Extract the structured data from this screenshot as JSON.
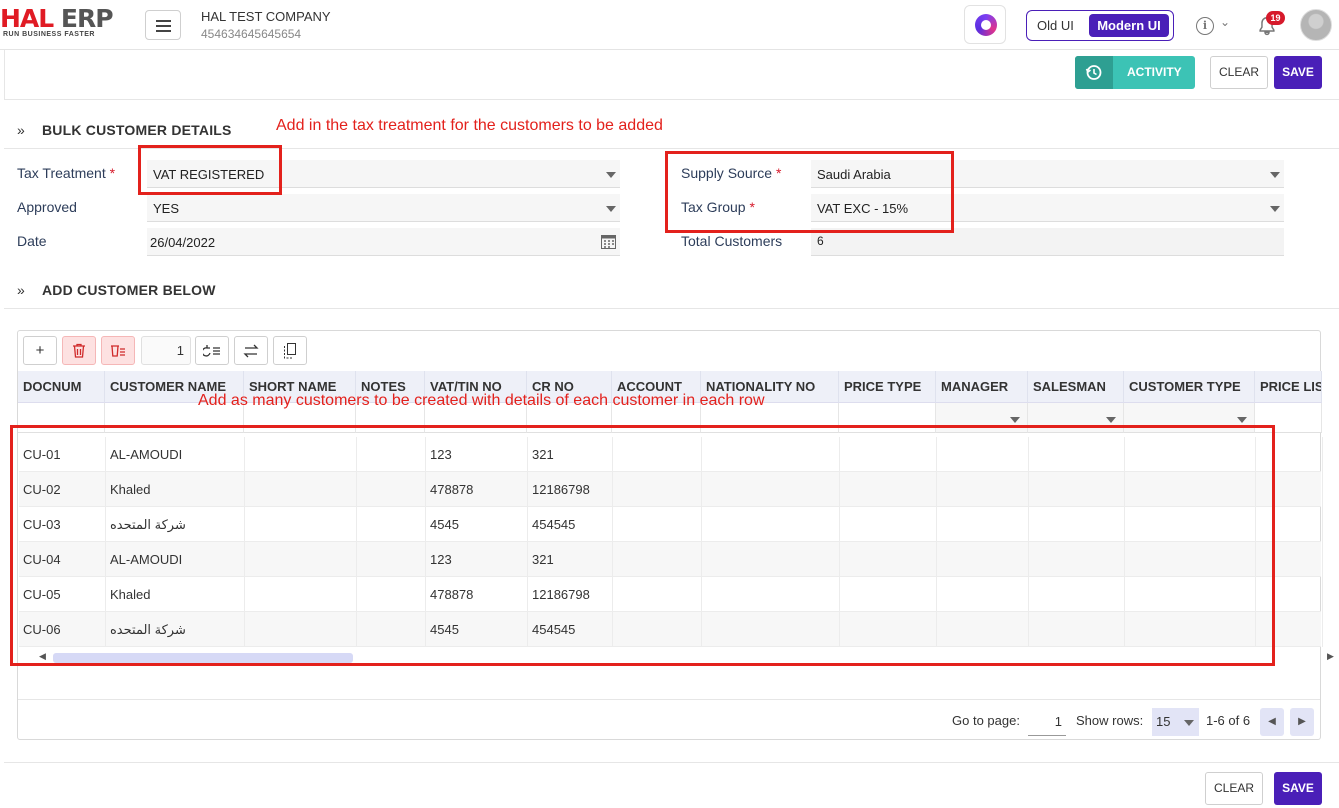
{
  "brand": {
    "logo_hal": "HAL",
    "logo_erp": "ERP",
    "tagline": "RUN BUSINESS FASTER"
  },
  "company": {
    "name": "HAL TEST COMPANY",
    "id": "454634645645654"
  },
  "ui_toggle": {
    "old": "Old UI",
    "modern": "Modern UI"
  },
  "notifications": {
    "count": "19"
  },
  "toolbar": {
    "activity": "ACTIVITY",
    "clear": "CLEAR",
    "save": "SAVE"
  },
  "section1": {
    "title": "BULK CUSTOMER DETAILS"
  },
  "form": {
    "tax_treatment": {
      "label": "Tax Treatment",
      "req": "*",
      "value": "VAT REGISTERED"
    },
    "approved": {
      "label": "Approved",
      "value": "YES"
    },
    "date": {
      "label": "Date",
      "value": "26/04/2022"
    },
    "supply_source": {
      "label": "Supply Source",
      "req": "*",
      "value": "Saudi Arabia"
    },
    "tax_group": {
      "label": "Tax Group",
      "req": "*",
      "value": "VAT EXC - 15%"
    },
    "total_customers": {
      "label": "Total Customers",
      "value": "6"
    }
  },
  "section2": {
    "title": "ADD CUSTOMER BELOW"
  },
  "annotations": {
    "top": "Add in the tax treatment for the customers to be added",
    "grid": "Add as many customers to be created with details of each customer in each row"
  },
  "grid": {
    "page_input": "1",
    "columns": [
      "DOCNUM",
      "CUSTOMER NAME",
      "SHORT NAME",
      "NOTES",
      "VAT/TIN NO",
      "CR NO",
      "ACCOUNT",
      "NATIONALITY NO",
      "PRICE TYPE",
      "MANAGER",
      "SALESMAN",
      "CUSTOMER TYPE",
      "PRICE LIST"
    ],
    "rows": [
      [
        "CU-01",
        "AL-AMOUDI",
        "",
        "",
        "123",
        "321"
      ],
      [
        "CU-02",
        "Khaled",
        "",
        "",
        "478878",
        "12186798"
      ],
      [
        "CU-03",
        "شركة المتحده",
        "",
        "",
        "4545",
        "454545"
      ],
      [
        "CU-04",
        "AL-AMOUDI",
        "",
        "",
        "123",
        "321"
      ],
      [
        "CU-05",
        "Khaled",
        "",
        "",
        "478878",
        "12186798"
      ],
      [
        "CU-06",
        "شركة المتحده",
        "",
        "",
        "4545",
        "454545"
      ]
    ],
    "footer": {
      "goto_label": "Go to page:",
      "goto_value": "1",
      "show_rows_label": "Show rows:",
      "show_rows_value": "15",
      "range": "1-6 of 6"
    }
  },
  "bottom": {
    "clear": "CLEAR",
    "save": "SAVE"
  }
}
